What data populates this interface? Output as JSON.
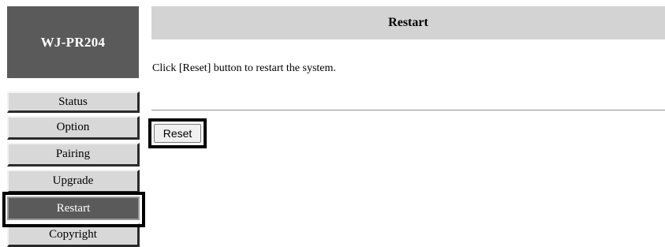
{
  "device": {
    "name": "WJ-PR204"
  },
  "menu": {
    "items": [
      {
        "label": "Status"
      },
      {
        "label": "Option"
      },
      {
        "label": "Pairing"
      },
      {
        "label": "Upgrade"
      },
      {
        "label": "Restart",
        "active": true
      },
      {
        "label": "Copyright"
      }
    ]
  },
  "main": {
    "title": "Restart",
    "instruction": "Click [Reset] button to restart the system.",
    "reset_label": "Reset"
  },
  "colors": {
    "device_box_bg": "#5a5a5a",
    "header_bg": "#d3d3d3",
    "menu_item_bg": "#d8d8d8",
    "menu_active_bg": "#5a5a5a"
  }
}
